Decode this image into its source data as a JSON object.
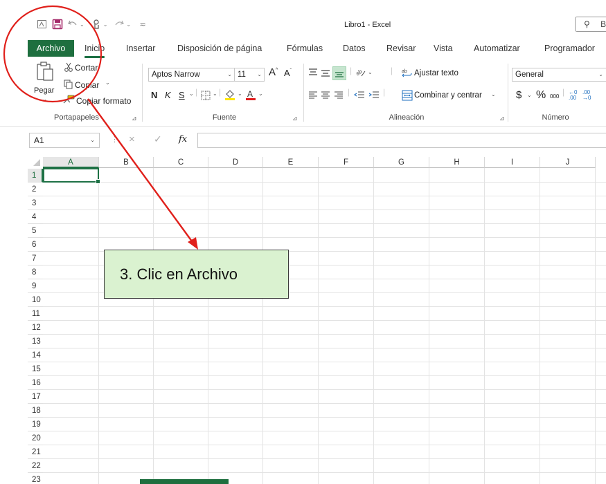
{
  "window": {
    "title": "Libro1 - Excel",
    "search_text": "B"
  },
  "qat": {
    "icons": [
      "autosave-icon",
      "save-icon",
      "undo-icon",
      "touch-mode-icon",
      "redo-icon",
      "customize-icon"
    ]
  },
  "tabs": [
    {
      "label": "Archivo"
    },
    {
      "label": "Inicio"
    },
    {
      "label": "Insertar"
    },
    {
      "label": "Disposición de página"
    },
    {
      "label": "Fórmulas"
    },
    {
      "label": "Datos"
    },
    {
      "label": "Revisar"
    },
    {
      "label": "Vista"
    },
    {
      "label": "Automatizar"
    },
    {
      "label": "Programador"
    }
  ],
  "ribbon": {
    "clipboard": {
      "paste": "Pegar",
      "cut": "Cortar",
      "copy": "Copiar",
      "format_painter": "Copiar formato",
      "label": "Portapapeles"
    },
    "font": {
      "font_name": "Aptos Narrow",
      "font_size": "11",
      "bold": "N",
      "italic": "K",
      "underline": "S",
      "label": "Fuente"
    },
    "alignment": {
      "wrap_text": "Ajustar texto",
      "merge_center": "Combinar y centrar",
      "label": "Alineación"
    },
    "number": {
      "format": "General",
      "label": "Número"
    }
  },
  "formula_bar": {
    "name_box": "A1",
    "fx": "fx"
  },
  "grid": {
    "columns": [
      "A",
      "B",
      "C",
      "D",
      "E",
      "F",
      "G",
      "H",
      "I",
      "J"
    ],
    "rows": [
      "1",
      "2",
      "3",
      "4",
      "5",
      "6",
      "7",
      "8",
      "9",
      "10",
      "11",
      "12",
      "13",
      "14",
      "15",
      "16",
      "17",
      "18",
      "19",
      "20",
      "21",
      "22",
      "23"
    ],
    "selected_cell": "A1"
  },
  "annotation": {
    "callout_text": "3. Clic en Archivo",
    "accent_color": "#e0201b",
    "callout_fill": "#daf2d0"
  },
  "colors": {
    "excel_green": "#1e6f3f"
  }
}
